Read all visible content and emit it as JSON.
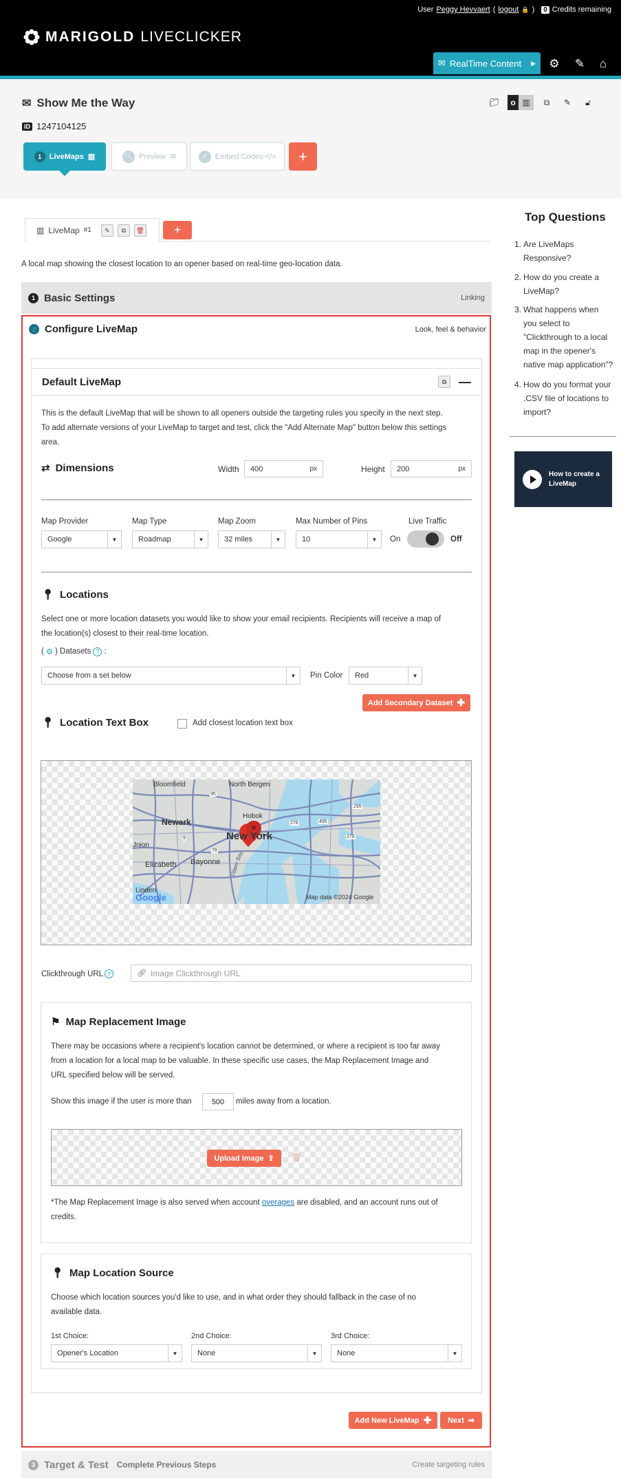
{
  "topbar": {
    "user_prefix": "User",
    "user_name": "Peggy Hevvaert",
    "logout": "logout",
    "credits_count": "0",
    "credits_label": "Credits remaining",
    "logo_bold": "MARIGOLD",
    "logo_light": "LIVECLICKER",
    "realtime_label": "RealTime Content"
  },
  "header": {
    "title": "Show Me the Way",
    "id_tag": "ID",
    "id_value": "1247104125",
    "steps": {
      "s1_num": "1",
      "s1": "LiveMaps",
      "s2": "Preview",
      "s3": "Embed Codes </>",
      "s4": "+"
    },
    "tool_o": "o"
  },
  "tabs": {
    "livemap1": "LiveMap",
    "livemap1_num": "#1",
    "add": "+"
  },
  "description": "A local map showing the closest location to an opener based on real-time geo-location data.",
  "sections": {
    "basic": {
      "num": "1",
      "title": "Basic Settings",
      "right": "Linking"
    },
    "configure": {
      "num": "2",
      "title": "Configure LiveMap",
      "right": "Look, feel & behavior"
    },
    "target": {
      "num": "3",
      "title": "Target & Test",
      "sub": "Complete Previous Steps",
      "right": "Create targeting rules"
    }
  },
  "default_livemap": {
    "title": "Default LiveMap",
    "intro_1": "This is the default LiveMap that will be shown to all openers outside the targeting rules you specify in the next step.",
    "intro_2": "To add alternate versions of your LiveMap to target and test, click the \"Add Alternate Map\" button below this settings",
    "intro_3": "area."
  },
  "dimensions": {
    "title": "Dimensions",
    "width_label": "Width",
    "width": "400",
    "height_label": "Height",
    "height": "200",
    "unit": "px"
  },
  "map_settings": {
    "provider_label": "Map Provider",
    "provider": "Google",
    "type_label": "Map Type",
    "type": "Roadmap",
    "zoom_label": "Map Zoom",
    "zoom": "32 miles",
    "pins_label": "Max Number of Pins",
    "pins": "10",
    "traffic_label": "Live Traffic",
    "on": "On",
    "off": "Off"
  },
  "locations": {
    "title": "Locations",
    "desc_1": "Select one or more location datasets you would like to show your email recipients. Recipients will receive a map of",
    "desc_2": "the location(s) closest to their real-time location.",
    "datasets_label": "Datasets",
    "dataset_select": "Choose from a set below",
    "pin_color_label": "Pin Color",
    "pin_color": "Red",
    "add_secondary": "Add Secondary Dataset"
  },
  "location_text_box": {
    "title": "Location Text Box",
    "checkbox_label": "Add closest location text box"
  },
  "map_labels": {
    "bloomfield": "Bloomfield",
    "north_bergen": "North Bergen",
    "newark": "Newark",
    "hoboken": "Hobok",
    "new_york": "New York",
    "union": "Jnion",
    "elizabeth": "Elizabeth",
    "bayonne": "Bayonne",
    "upper_bay": "Upper Bay",
    "linden": "Linden",
    "google": "Google",
    "map_data": "Map data ©2024 Google",
    "r278a": "278",
    "r495": "495",
    "r278b": "278",
    "r9": "9",
    "r78": "78",
    "r95": "95",
    "r295": "295"
  },
  "clickthrough": {
    "label": "Clickthrough URL",
    "placeholder": "Image Clickthrough URL"
  },
  "replacement": {
    "title": "Map Replacement Image",
    "desc_1": "There may be occasions where a recipient's location cannot be determined, or where a recipient is too far away",
    "desc_2": "from a location for a local map to be valuable. In these specific use cases, the Map Replacement Image and",
    "desc_3": "URL specified below will be served.",
    "show_prefix": "Show this image if the user is more than",
    "miles": "500",
    "show_suffix": "miles away from a location.",
    "upload": "Upload Image",
    "note_1": "*The Map Replacement Image is also served when account",
    "note_link": "overages",
    "note_2": "are disabled, and an account runs out of",
    "note_3": "credits."
  },
  "location_source": {
    "title": "Map Location Source",
    "desc_1": "Choose which location sources you'd like to use, and in what order they should fallback in the case of no",
    "desc_2": "available data.",
    "c1_label": "1st Choice:",
    "c1": "Opener's Location",
    "c2_label": "2nd Choice:",
    "c2": "None",
    "c3_label": "3rd Choice:",
    "c3": "None"
  },
  "actions": {
    "add_new": "Add New LiveMap",
    "next": "Next"
  },
  "sidebar": {
    "title": "Top Questions",
    "q1n": "1.",
    "q1a": "Are LiveMaps",
    "q1b": "Responsive?",
    "q2n": "2.",
    "q2a": "How do you create a",
    "q2b": "LiveMap?",
    "q3n": "3.",
    "q3a": "What happens when",
    "q3b": "you select to",
    "q3c": "\"Clickthrough to a local",
    "q3d": "map in the opener's",
    "q3e": "native map application\"?",
    "q4n": "4.",
    "q4a": "How do you format your",
    "q4b": ".CSV file of locations to",
    "q4c": "import?",
    "video_1": "How to create a",
    "video_2": "LiveMap"
  }
}
